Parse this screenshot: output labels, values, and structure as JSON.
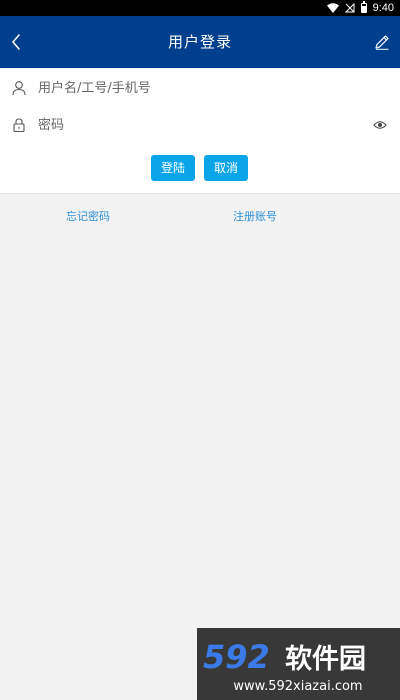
{
  "status_bar": {
    "time": "9:40"
  },
  "header": {
    "title": "用户登录",
    "bg_color": "#003f8d"
  },
  "form": {
    "username_placeholder": "用户名/工号/手机号",
    "password_placeholder": "密码",
    "login_label": "登陆",
    "cancel_label": "取消",
    "button_color": "#0aa5e9"
  },
  "links": {
    "forgot_password": "忘记密码",
    "register": "注册账号",
    "link_color": "#2c8fd8"
  },
  "watermark": {
    "brand": "592软件园",
    "url": "www.592xiazai.com"
  },
  "icons": {
    "back": "chevron-left-icon",
    "edit": "pencil-icon",
    "user": "user-icon",
    "lock": "lock-icon",
    "eye": "eye-icon",
    "wifi": "wifi-icon",
    "signal": "no-signal-icon",
    "battery": "battery-icon"
  }
}
